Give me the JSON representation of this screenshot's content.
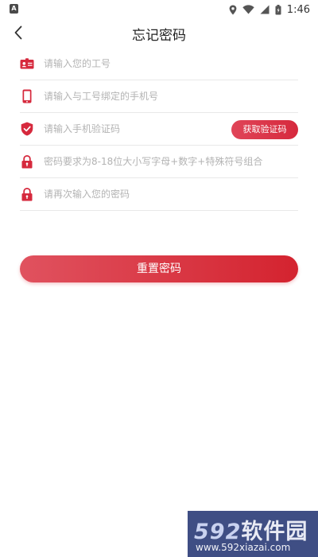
{
  "status_bar": {
    "app_badge": "A",
    "time": "1:46"
  },
  "nav": {
    "title": "忘记密码"
  },
  "form": {
    "fields": [
      {
        "icon": "id-card-icon",
        "placeholder": "请输入您的工号",
        "value": ""
      },
      {
        "icon": "phone-icon",
        "placeholder": "请输入与工号绑定的手机号",
        "value": ""
      },
      {
        "icon": "shield-check-icon",
        "placeholder": "请输入手机验证码",
        "value": ""
      },
      {
        "icon": "lock-icon",
        "placeholder": "密码要求为8-18位大小写字母+数字+特殊符号组合",
        "value": ""
      },
      {
        "icon": "lock-icon",
        "placeholder": "请再次输入您的密码",
        "value": ""
      }
    ],
    "get_code_label": "获取验证码"
  },
  "actions": {
    "reset_label": "重置密码"
  },
  "watermark": {
    "logo_num": "592",
    "logo_text": "软件园",
    "url": "www.592xiazai.com"
  },
  "colors": {
    "accent": "#d6293d",
    "accent_light": "#e0525f",
    "placeholder": "#b3b3b3",
    "divider": "#e8e8e8",
    "watermark_bg": "#3f4e84"
  }
}
